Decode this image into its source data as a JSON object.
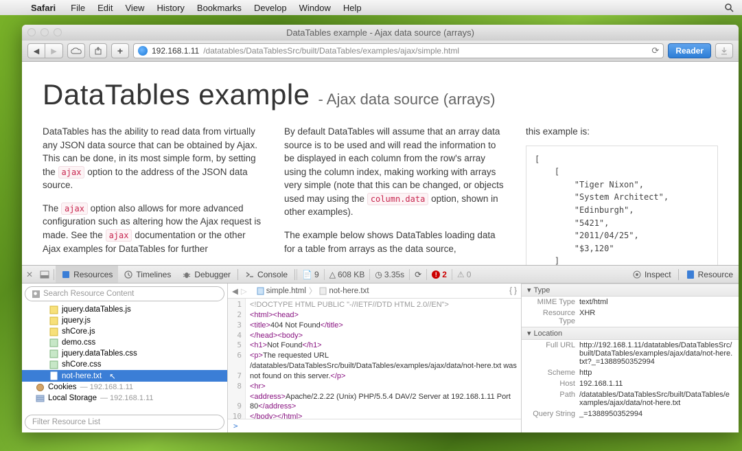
{
  "menubar": {
    "app": "Safari",
    "items": [
      "File",
      "Edit",
      "View",
      "History",
      "Bookmarks",
      "Develop",
      "Window",
      "Help"
    ]
  },
  "window": {
    "title": "DataTables example - Ajax data source (arrays)"
  },
  "url": {
    "host": "192.168.1.11",
    "path": "/datatables/DataTablesSrc/built/DataTables/examples/ajax/simple.html",
    "reader": "Reader"
  },
  "page": {
    "title": "DataTables example",
    "subtitle": "- Ajax data source (arrays)",
    "col1_p1a": "DataTables has the ability to read data from virtually any JSON data source that can be obtained by Ajax. This can be done, in its most simple form, by setting the ",
    "col1_p1b": " option to the address of the JSON data source.",
    "col1_p2a": "The ",
    "col1_p2b": " option also allows for more advanced configuration such as altering how the Ajax request is made. See the ",
    "col1_p2c": " documentation or the other Ajax examples for DataTables for further",
    "code_ajax": "ajax",
    "col2_p1a": "By default DataTables will assume that an array data source is to be used and will read the information to be displayed in each column from the row's array using the column index, making working with arrays very simple (note that this can be changed, or objects used may using the ",
    "code_coldata": "column.data",
    "col2_p1b": " option, shown in other examples).",
    "col2_p2": "The example below shows DataTables loading data for a table from arrays as the data source,",
    "col3_p1": "this example is:",
    "json_sample": "[\n    [\n        \"Tiger Nixon\",\n        \"System Architect\",\n        \"Edinburgh\",\n        \"5421\",\n        \"2011/04/25\",\n        \"$3,120\"\n    ]"
  },
  "devtools": {
    "tabs": {
      "resources": "Resources",
      "timelines": "Timelines",
      "debugger": "Debugger",
      "console": "Console",
      "inspect": "Inspect",
      "resource": "Resource"
    },
    "stats": {
      "docs": "9",
      "size": "608 KB",
      "time": "3.35s",
      "errors": "2",
      "warnings": "0"
    },
    "search_ph": "Search Resource Content",
    "filter_ph": "Filter Resource List",
    "tree": {
      "f0": "jquery.dataTables.js",
      "f1": "jquery.js",
      "f2": "shCore.js",
      "f3": "demo.css",
      "f4": "jquery.dataTables.css",
      "f5": "shCore.css",
      "f6": "not-here.txt",
      "cookies": "Cookies",
      "cookies_host": "— 192.168.1.11",
      "local": "Local Storage",
      "local_host": "— 192.168.1.11"
    },
    "crumb": {
      "c1": "simple.html",
      "c2": "not-here.txt"
    },
    "source": {
      "l1": "<!DOCTYPE HTML PUBLIC \"-//IETF//DTD HTML 2.0//EN\">",
      "l2_open": "<html>",
      "l2_open2": "<head>",
      "l3_open": "<title>",
      "l3_txt": "404 Not Found",
      "l3_close": "</title>",
      "l4": "</head>",
      "l4b": "<body>",
      "l5_open": "<h1>",
      "l5_txt": "Not Found",
      "l5_close": "</h1>",
      "l6_open": "<p>",
      "l6_txt": "The requested URL /datatables/DataTablesSrc/built/DataTables/examples/ajax/data/not-here.txt was not found on this server.",
      "l6_close": "</p>",
      "l7": "<hr>",
      "l8_open": "<address>",
      "l8_txt": "Apache/2.2.22 (Unix) PHP/5.5.4 DAV/2 Server at 192.168.1.11 Port 80",
      "l8_close": "</address>",
      "l9": "</body>",
      "l9b": "</html>"
    },
    "details": {
      "type_h": "Type",
      "mime_k": "MIME Type",
      "mime_v": "text/html",
      "restype_k": "Resource Type",
      "restype_v": "XHR",
      "loc_h": "Location",
      "fullurl_k": "Full URL",
      "fullurl_v": "http://192.168.1.11/datatables/DataTablesSrc/built/DataTables/examples/ajax/data/not-here.txt?_=1388950352994",
      "scheme_k": "Scheme",
      "scheme_v": "http",
      "host_k": "Host",
      "host_v": "192.168.1.11",
      "path_k": "Path",
      "path_v": "/datatables/DataTablesSrc/built/DataTables/examples/ajax/data/not-here.txt",
      "qs_k": "Query String",
      "qs_v": "_=1388950352994"
    }
  }
}
